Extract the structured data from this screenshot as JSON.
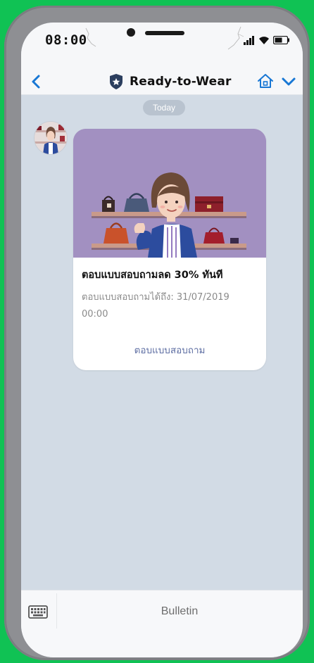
{
  "status_bar": {
    "time": "08:00"
  },
  "header": {
    "title": "Ready-to-Wear",
    "back_icon": "chevron-left-icon",
    "shield_icon": "shield-star-icon",
    "home_icon": "home-icon",
    "menu_icon": "chevron-down-icon",
    "accent_color": "#1877d4"
  },
  "chat": {
    "date_label": "Today",
    "message": {
      "title": "ตอบแบบสอบถามลด 30% ทันที",
      "subtitle": "ตอบแบบสอบถามได้ถึง: 31/07/2019 00:00",
      "action_label": "ตอบแบบสอบถาม",
      "image_background": "#a290c1"
    }
  },
  "bottom_bar": {
    "keyboard_icon": "keyboard-icon",
    "label": "Bulletin"
  },
  "colors": {
    "frame_green": "#10c254",
    "chat_background": "#d2dbe5",
    "link_color": "#5f6fa3"
  }
}
